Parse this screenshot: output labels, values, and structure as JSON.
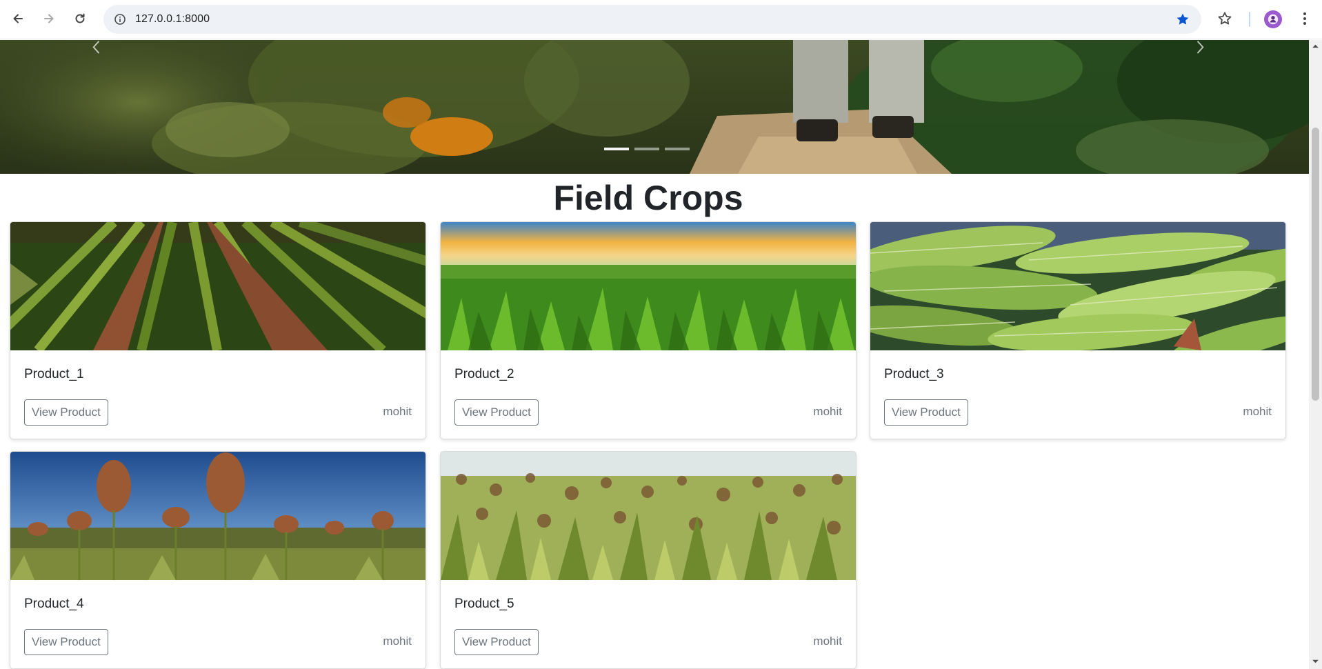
{
  "browser": {
    "url": "127.0.0.1:8000",
    "back_icon": "arrow-left-icon",
    "forward_icon": "arrow-right-icon",
    "reload_icon": "reload-icon",
    "site_info_icon": "info-icon",
    "bookmark_icon": "star-filled-icon",
    "bookmarks_menu_icon": "star-outline-icon",
    "menu_icon": "kebab-menu-icon",
    "bookmark_color": "#0b57d0"
  },
  "carousel": {
    "slide_count": 3,
    "active_index": 0
  },
  "section": {
    "title": "Field Crops"
  },
  "products": [
    {
      "name": "Product_1",
      "button": "View Product",
      "author": "mohit",
      "image": "crop-rows-field"
    },
    {
      "name": "Product_2",
      "button": "View Product",
      "author": "mohit",
      "image": "corn-field-sunset"
    },
    {
      "name": "Product_3",
      "button": "View Product",
      "author": "mohit",
      "image": "corn-cobs"
    },
    {
      "name": "Product_4",
      "button": "View Product",
      "author": "mohit",
      "image": "sorghum-blue-sky"
    },
    {
      "name": "Product_5",
      "button": "View Product",
      "author": "mohit",
      "image": "millet-field"
    }
  ]
}
